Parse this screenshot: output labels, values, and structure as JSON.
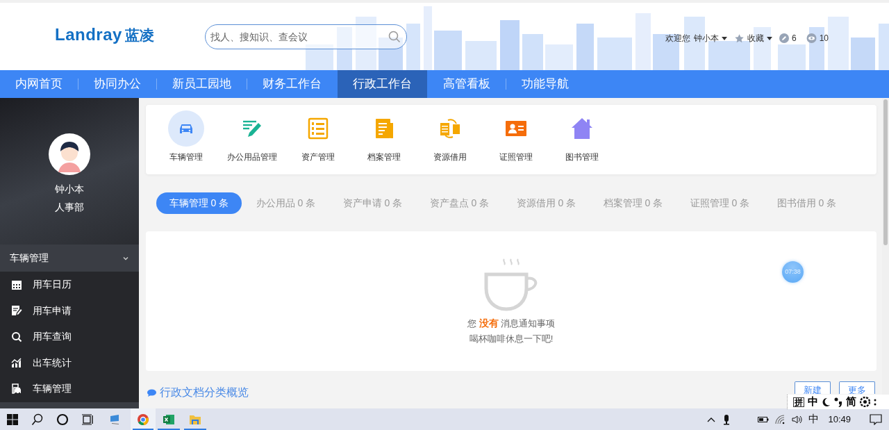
{
  "header": {
    "logo": "Landray",
    "logo_cn": "蓝凌",
    "search": {
      "placeholder": "找人、搜知识、查会议"
    },
    "welcome": "欢迎您",
    "user_name": "钟小本",
    "favorites": "收藏",
    "edits": "6",
    "views": "10"
  },
  "nav": [
    {
      "label": "内网首页",
      "selected": false
    },
    {
      "label": "协同办公",
      "selected": false
    },
    {
      "label": "新员工园地",
      "selected": false
    },
    {
      "label": "财务工作台",
      "selected": false
    },
    {
      "label": "行政工作台",
      "selected": true
    },
    {
      "label": "高管看板",
      "selected": false
    },
    {
      "label": "功能导航",
      "selected": false
    }
  ],
  "sidebar": {
    "name": "钟小本",
    "department": "人事部",
    "section": {
      "label": "车辆管理",
      "expanded": true
    },
    "items": [
      {
        "label": "用车日历",
        "kind": "calendar"
      },
      {
        "label": "用车申请",
        "kind": "apply"
      },
      {
        "label": "用车查询",
        "kind": "search"
      },
      {
        "label": "出车统计",
        "kind": "stats"
      },
      {
        "label": "车辆管理",
        "kind": "vehicle"
      }
    ]
  },
  "apps": [
    {
      "label": "车辆管理",
      "kind": "car",
      "selected": true
    },
    {
      "label": "办公用品管理",
      "kind": "pen",
      "selected": false
    },
    {
      "label": "资产管理",
      "kind": "list",
      "selected": false
    },
    {
      "label": "档案管理",
      "kind": "doc",
      "selected": false
    },
    {
      "label": "资源借用",
      "kind": "swap",
      "selected": false
    },
    {
      "label": "证照管理",
      "kind": "card",
      "selected": false
    },
    {
      "label": "图书管理",
      "kind": "kms",
      "selected": false
    }
  ],
  "tabs": [
    {
      "label": "车辆管理 0 条",
      "selected": true
    },
    {
      "label": "办公用品 0 条",
      "selected": false
    },
    {
      "label": "资产申请 0 条",
      "selected": false
    },
    {
      "label": "资产盘点 0 条",
      "selected": false
    },
    {
      "label": "资源借用 0 条",
      "selected": false
    },
    {
      "label": "档案管理 0 条",
      "selected": false
    },
    {
      "label": "证照管理 0 条",
      "selected": false
    },
    {
      "label": "图书借用 0 条",
      "selected": false
    }
  ],
  "empty_state": {
    "message": "您 **没有** 消息通知事项",
    "hint": "喝杯咖啡休息一下吧!"
  },
  "section": {
    "title": "行政文档分类概览",
    "buttons": [
      "新建",
      "更多"
    ]
  },
  "timer": "07:38",
  "ime_toolbar": [
    "拼",
    "中",
    "简"
  ],
  "taskbar": {
    "input_mode": "中",
    "clock": "10:49"
  }
}
